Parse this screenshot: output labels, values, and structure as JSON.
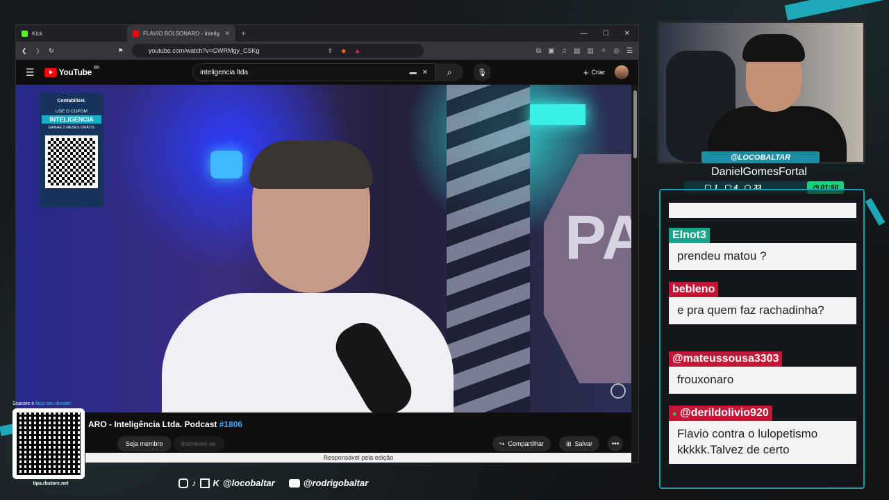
{
  "browser": {
    "tabs": [
      {
        "label": "Kick",
        "active": false
      },
      {
        "label": "FLÁVIO BOLSONARO - Inteligência",
        "active": true
      }
    ],
    "url": "youtube.com/watch?v=GWRMgy_CSKg"
  },
  "youtube": {
    "logo": "YouTube",
    "country": "BR",
    "search_value": "inteligencia ltda",
    "create_label": "Criar",
    "video_title_text": "ARO - Inteligência Ltda. Podcast ",
    "video_title_tag": "#1806",
    "member_label": "Seja membro",
    "subscribe_label": "Inscrever-se",
    "share_label": "Compartilhar",
    "save_label": "Salvar",
    "edit_note": "Responsável pela edição"
  },
  "promo": {
    "brand": "Contabilizei.",
    "use": "USE O CUPOM",
    "code": "INTELIGENCIA",
    "gift": "GANHE 2 MESES GRÁTIS"
  },
  "video_scene": {
    "sign_text": "PA"
  },
  "tip": {
    "caption_a": "Scaneie e ",
    "caption_b": "faça seu donate!",
    "url": "tipa.rbstore.net"
  },
  "socials": {
    "kick": "@locobaltar",
    "youtube": "@rodrigobaltar"
  },
  "cam": {
    "handle": "@LOCOBALTAR",
    "name": "DanielGomesFortal",
    "stats": {
      "chat": "1",
      "video": "4",
      "viewers": "33",
      "time": "01:50"
    }
  },
  "chat": [
    {
      "user": "Elnot3",
      "text": "prendeu matou ?",
      "color": "#1aa58a"
    },
    {
      "user": "bebleno",
      "text": "e pra quem faz rachadinha?",
      "color": "#c41636"
    },
    {
      "user": "@mateussousa3303",
      "text": "frouxonaro",
      "color": "#c41636"
    },
    {
      "user": "@derildolivio920",
      "text": "Flavio contra o lulopetismo kkkkk.Talvez de certo",
      "color": "#c41636"
    }
  ]
}
